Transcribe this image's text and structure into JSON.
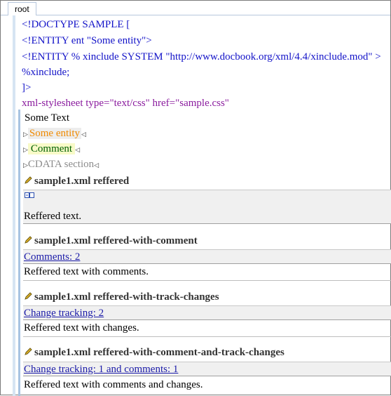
{
  "tab": {
    "label": "root"
  },
  "doctype": {
    "line1": "<!DOCTYPE SAMPLE [",
    "line2": "<!ENTITY ent \"Some entity\">",
    "line3": "<!ENTITY % xinclude SYSTEM \"http://www.docbook.org/xml/4.4/xinclude.mod\" >",
    "line4": "%xinclude;",
    "line5": "]>"
  },
  "pi": "xml-stylesheet type=\"text/css\" href=\"sample.css\"",
  "content": {
    "some_text": "Some Text",
    "entity": "Some entity",
    "comment": "Comment",
    "cdata": "CDATA section"
  },
  "refs": [
    {
      "title": "sample1.xml reffered",
      "link": "",
      "text": "Reffered text."
    },
    {
      "title": "sample1.xml reffered-with-comment",
      "link": "Comments: 2",
      "text": "Reffered text with comments."
    },
    {
      "title": "sample1.xml reffered-with-track-changes",
      "link": "Change tracking: 2",
      "text": "Reffered text with  changes."
    },
    {
      "title": "sample1.xml reffered-with-comment-and-track-changes",
      "link": "Change tracking: 1 and comments: 1",
      "text": "Reffered text with comments and  changes."
    }
  ],
  "colors": {
    "doctype": "#1212c8",
    "pi": "#8a1b9e",
    "entity": "#f08a00",
    "comment": "#006000",
    "link": "#1a1aa8"
  },
  "icons": {
    "ref": "pencil-icon",
    "expand": "expand-fold-icon"
  }
}
